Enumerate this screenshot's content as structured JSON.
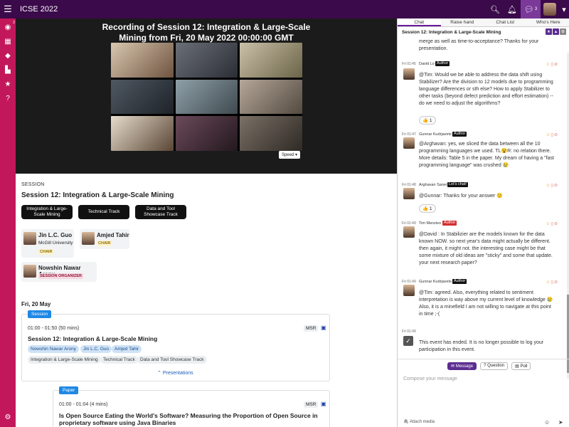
{
  "topbar": {
    "title": "ICSE 2022",
    "chat_count": "3"
  },
  "leftnav": {
    "badge": "2"
  },
  "video": {
    "title_line1": "Recording of Session 12: Integration & Large-Scale",
    "title_line2": "Mining from Fri, 20 May 2022 00:00:00 GMT",
    "speed": "Speed"
  },
  "session": {
    "label": "SESSION",
    "title": "Session 12: Integration & Large-Scale Mining",
    "tracks": [
      "Integration & Large-Scale Mining",
      "Technical Track",
      "Data and Tool Showcase Track"
    ],
    "people": [
      {
        "name": "Jin L.C. Guo",
        "affil": "McGill University",
        "role": "CHAIR"
      },
      {
        "name": "Amjed Tahir",
        "affil": "",
        "role": "CHAIR"
      },
      {
        "name": "Nowshin Nawar Arony",
        "affil": "",
        "role": "SESSION ORGANIZER"
      }
    ],
    "date": "Fri, 20 May",
    "event1": {
      "tag": "Session",
      "time": "01:00 - 01:50 (50 mins)",
      "venue": "MSR",
      "title": "Session 12: Integration & Large-Scale Mining",
      "people": [
        "Nowshin Nawar Arony",
        "Jin L.C. Guo",
        "Amjed Tahir"
      ],
      "tracks": [
        "Integration & Large-Scale Mining",
        "Technical Track",
        "Data and Tool Showcase Track"
      ],
      "presentations": "Presentations"
    },
    "event2": {
      "tag": "Paper",
      "time": "01:00 - 01:04 (4 mins)",
      "venue": "MSR",
      "title_line1": "Is Open Source Eating the World's Software? Measuring the Proportion of Open Source in",
      "title_line2": "proprietary software using Java Binaries"
    }
  },
  "chat": {
    "tabs": [
      "Chat",
      "Raise hand",
      "Chat List",
      "Who's Here"
    ],
    "header": "Session 12: Integration & Large-Scale Mining",
    "messages": [
      {
        "lines": [
          "merge as well as time-to-acceptance? Thanks for your",
          "presentation."
        ]
      },
      {
        "time": "Fri 01:45",
        "user": "David Lo",
        "role": "Author",
        "lines": [
          "@Tim: Would we be able to address the data shift using",
          "Stabilizer? Are the division to 12 models due to programming",
          "language differences or sth else? How to apply Stabilizer to",
          "other tasks (beyond defect prediction and effort estimation) --",
          "do we need to adjust the algorithms?"
        ],
        "reaction": "👍 1"
      },
      {
        "time": "Fri 01:47",
        "user": "Gunnar Kudrjavets",
        "role": "Author",
        "lines": [
          "@Arghavan: yes, we sliced the data between all the 10",
          "programming languages we used. TL😵R: no relation there.",
          "More details: Table 5 in the paper. My dream of having a \"fast",
          "programming language\" was crushed 😢"
        ]
      },
      {
        "time": "Fri 01:48",
        "user": "Arghavan Sanei",
        "role": "Let's chat!",
        "lines": [
          "@Gunnar: Thanks for your answer 🙂"
        ],
        "reaction": "👍 1"
      },
      {
        "time": "Fri 01:49",
        "user": "Tim Menzies",
        "role": "Author",
        "lines": [
          "@David : In Stabilizier are the models known for the data",
          "known NOW. so next year's data might actually be different.",
          "then again, it might not. the interesting case might be that",
          "some mixture of old ideas are \"sticky\" and some that update.",
          "your next research paper?"
        ]
      },
      {
        "time": "Fri 01:49",
        "user": "Gunnar Kudrjavets",
        "role": "Author",
        "lines": [
          "@Tim: agreed. Also, everything related to sentiment",
          "interpretation is way above my current level of knowledge 😢",
          "Also, it is a minefield I am not willing to navigate at this point",
          "in time ;-("
        ]
      },
      {
        "time": "Fri 01:49",
        "lines": [
          "This event has ended. It is no longer possible to log your",
          "participation in this event."
        ]
      }
    ],
    "compose": {
      "buttons": [
        "Message",
        "Question",
        "Poll"
      ],
      "placeholder": "Compose your message",
      "attach": "Attach media"
    }
  }
}
